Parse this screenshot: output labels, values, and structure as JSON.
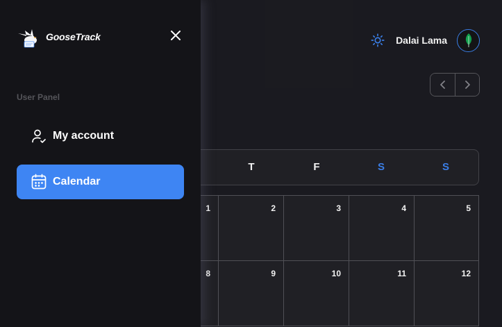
{
  "app": {
    "name": "GooseTrack"
  },
  "sidebar": {
    "panel_title": "User Panel",
    "items": [
      {
        "label": "My account",
        "icon": "user-check-icon",
        "active": false
      },
      {
        "label": "Calendar",
        "icon": "calendar-icon",
        "active": true
      }
    ],
    "close_icon": "close-icon"
  },
  "header": {
    "user_name": "Dalai Lama",
    "theme_icon": "sun-icon",
    "avatar_icon": "leaf-icon"
  },
  "navigation": {
    "prev_icon": "chevron-left-icon",
    "next_icon": "chevron-right-icon"
  },
  "calendar": {
    "weekdays": [
      "T",
      "F",
      "S",
      "S"
    ],
    "weekend_color": "#3e85f3",
    "rows": [
      [
        "1",
        "2",
        "3",
        "4",
        "5"
      ],
      [
        "8",
        "9",
        "10",
        "11",
        "12"
      ]
    ]
  },
  "colors": {
    "accent": "#3e85f3",
    "sidebar_bg": "#141418",
    "main_bg": "#1c1c22"
  }
}
